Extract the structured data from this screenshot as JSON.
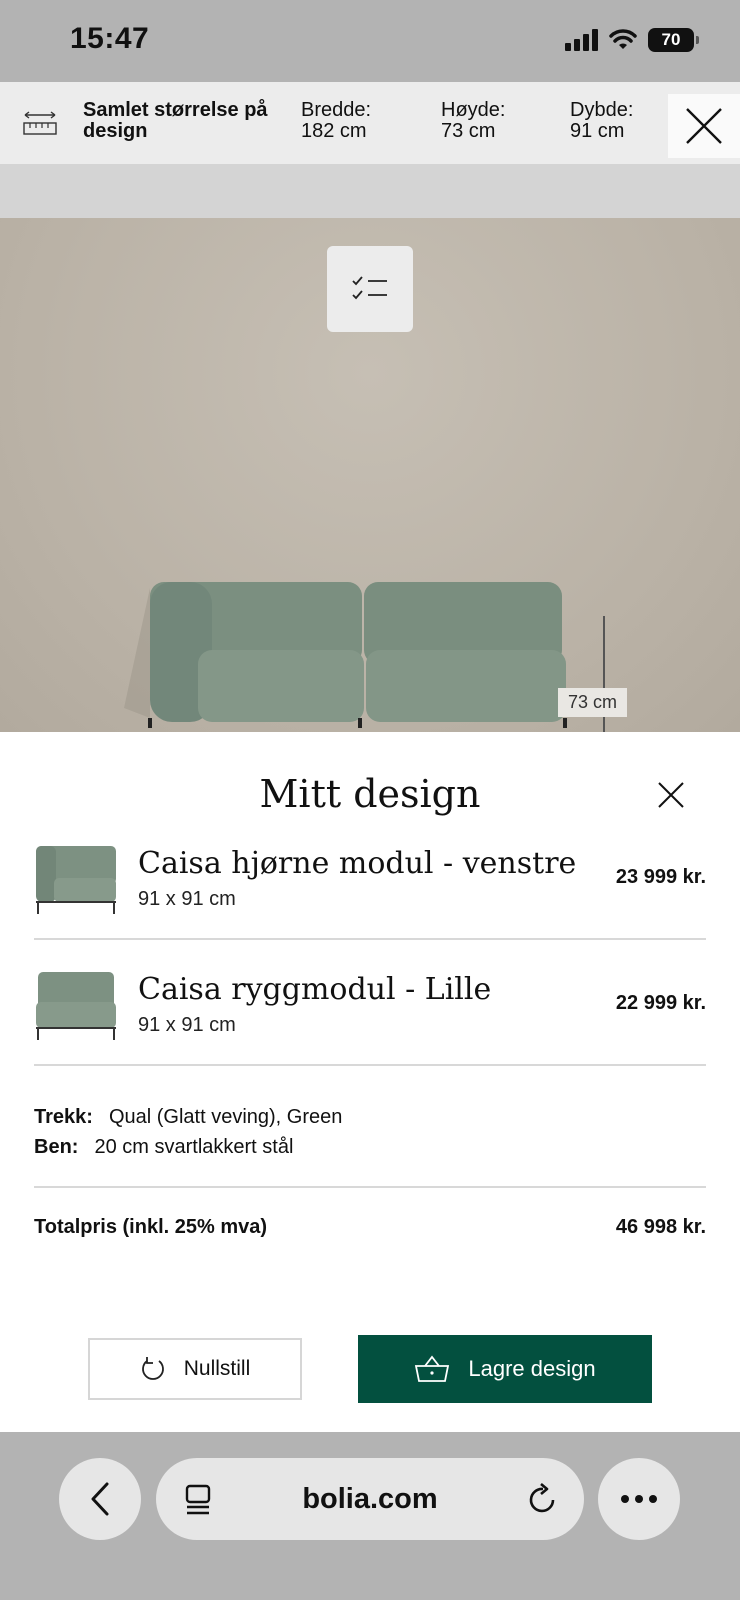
{
  "status": {
    "time": "15:47",
    "battery": "70"
  },
  "dimensions": {
    "title": "Samlet størrelse på design",
    "width_label": "Bredde:",
    "width_value": "182 cm",
    "height_label": "Høyde:",
    "height_value": "73 cm",
    "depth_label": "Dybde:",
    "depth_value": "91 cm"
  },
  "scene": {
    "height_label": "73 cm",
    "sofa_color": "#7d9282"
  },
  "panel": {
    "title": "Mitt design",
    "items": [
      {
        "name": "Caisa hjørne modul - venstre",
        "size": "91 x 91 cm",
        "price": "23 999 kr."
      },
      {
        "name": "Caisa ryggmodul - Lille",
        "size": "91 x 91 cm",
        "price": "22 999 kr."
      }
    ],
    "specs": {
      "fabric_label": "Trekk:",
      "fabric_value": "Qual (Glatt veving), Green",
      "legs_label": "Ben:",
      "legs_value": "20 cm svartlakkert stål"
    },
    "total_label": "Totalpris (inkl. 25% mva)",
    "total_value": "46 998 kr.",
    "reset_label": "Nullstill",
    "save_label": "Lagre design",
    "accent": "#03503f"
  },
  "browser": {
    "url": "bolia.com"
  }
}
